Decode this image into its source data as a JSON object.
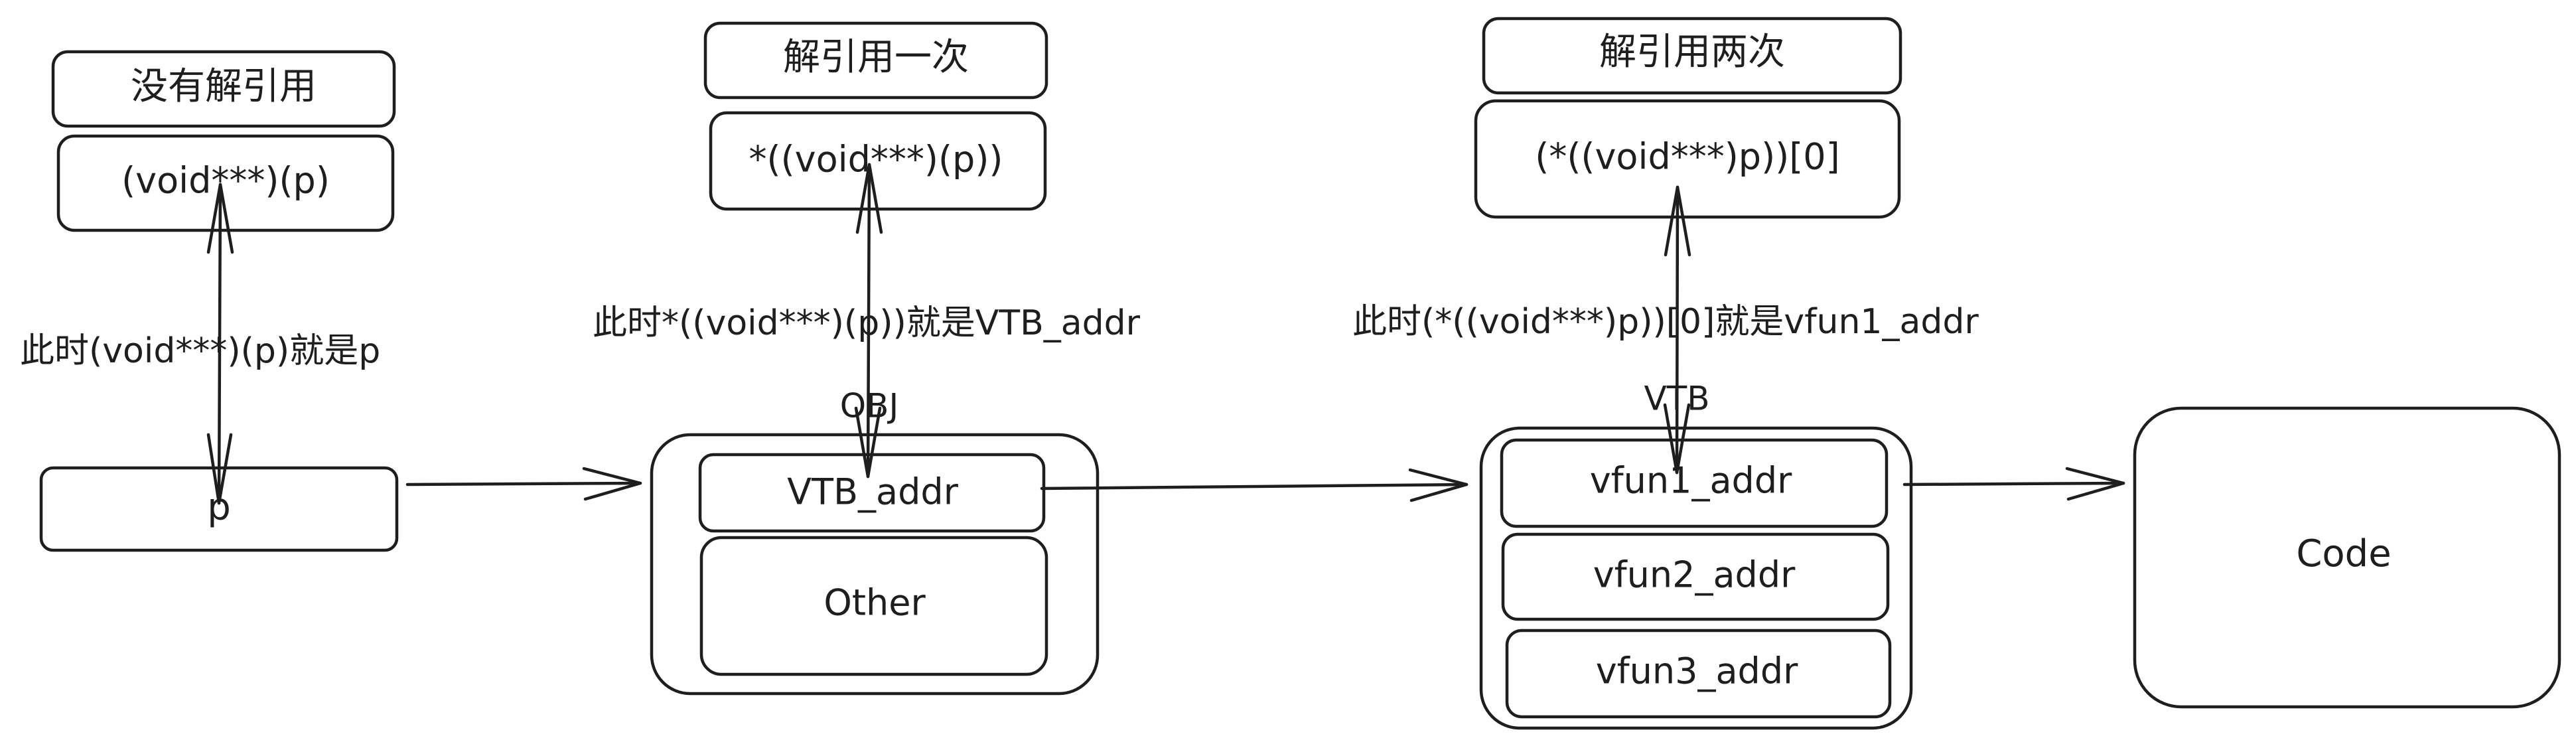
{
  "labels": {
    "no_deref": "没有解引用",
    "deref_once": "解引用一次",
    "deref_twice": "解引用两次"
  },
  "expressions": {
    "cast_p": "(void***)(p)",
    "deref_once_expr": "*((void***)(p))",
    "deref_twice_expr": "(*((void***)p))[0]"
  },
  "annotations": {
    "cast_is_p": "此时(void***)(p)就是p",
    "deref_once_is_vtb": "此时*((void***)(p))就是VTB_addr",
    "deref_twice_is_vfun1": "此时(*((void***)p))[0]就是vfun1_addr"
  },
  "nodes": {
    "p": "p",
    "obj_title": "OBJ",
    "vtb_addr": "VTB_addr",
    "other": "Other",
    "vtb_title": "VTB",
    "vfun1_addr": "vfun1_addr",
    "vfun2_addr": "vfun2_addr",
    "vfun3_addr": "vfun3_addr",
    "code": "Code"
  }
}
